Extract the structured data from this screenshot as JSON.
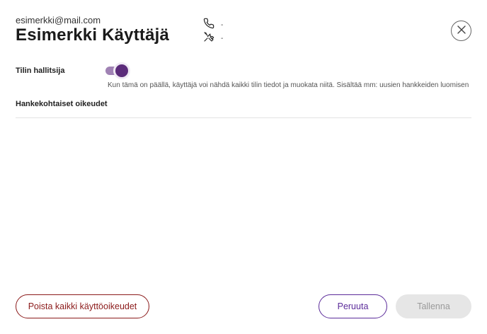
{
  "user": {
    "email": "esimerkki@mail.com",
    "name": "Esimerkki Käyttäjä",
    "phone": "-",
    "role": "-"
  },
  "account_admin": {
    "label": "Tilin hallitsija",
    "enabled": true,
    "description": "Kun tämä on päällä, käyttäjä voi nähdä kaikki tilin tiedot ja muokata niitä. Sisältää mm: uusien hankkeiden luomisen"
  },
  "project_permissions": {
    "label": "Hankekohtaiset oikeudet"
  },
  "actions": {
    "remove_all_label": "Poista kaikki käyttöoikeudet",
    "cancel_label": "Peruuta",
    "save_label": "Tallenna"
  },
  "colors": {
    "accent": "#5b2b7a",
    "danger": "#8b1a1a",
    "disabled_bg": "#e6e6e6"
  },
  "icons": {
    "phone": "phone-icon",
    "role": "tools-icon",
    "close": "close-icon"
  }
}
